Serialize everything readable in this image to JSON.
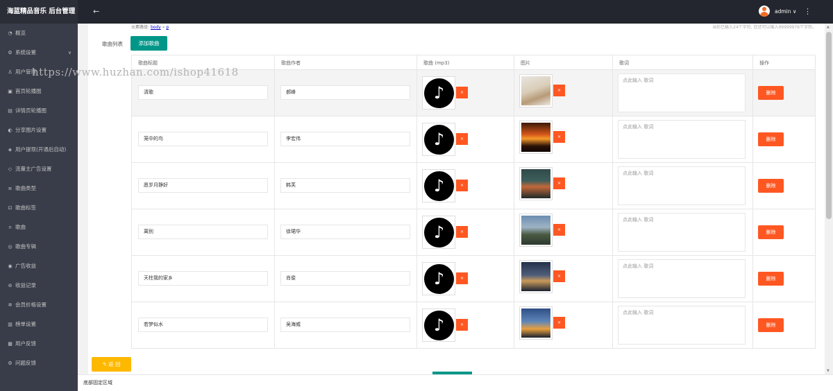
{
  "app": {
    "title": "海蓝精品音乐 后台管理"
  },
  "sidebar": {
    "items": [
      {
        "label": "概览",
        "icon": "gauge-icon",
        "glyph": "◔"
      },
      {
        "label": "系统设置",
        "icon": "gear-icon",
        "glyph": "⚙",
        "has_arrow": true
      },
      {
        "label": "用户管理",
        "icon": "user-icon",
        "glyph": "♙"
      },
      {
        "label": "首页轮播图",
        "icon": "image-icon",
        "glyph": "▣"
      },
      {
        "label": "详情页轮播图",
        "icon": "picture-icon",
        "glyph": "▤"
      },
      {
        "label": "分享图片设置",
        "icon": "share-icon",
        "glyph": "◐"
      },
      {
        "label": "用户提现(开通后自动)",
        "icon": "shield-icon",
        "glyph": "◈"
      },
      {
        "label": "流量主广告设置",
        "icon": "diamond-icon",
        "glyph": "◇"
      },
      {
        "label": "歌曲类型",
        "icon": "list-icon",
        "glyph": "≡"
      },
      {
        "label": "歌曲标签",
        "icon": "tag-icon",
        "glyph": "⊡"
      },
      {
        "label": "歌曲",
        "icon": "headphones-icon",
        "glyph": "∩"
      },
      {
        "label": "歌曲专辑",
        "icon": "album-icon",
        "glyph": "◎"
      },
      {
        "label": "广告收益",
        "icon": "ad-icon",
        "glyph": "◉"
      },
      {
        "label": "收益记录",
        "icon": "record-icon",
        "glyph": "⊚"
      },
      {
        "label": "会员价格设置",
        "icon": "asterisk-icon",
        "glyph": "✲"
      },
      {
        "label": "榜单设置",
        "icon": "rank-icon",
        "glyph": "▥"
      },
      {
        "label": "用户反馈",
        "icon": "feedback-icon",
        "glyph": "▦"
      },
      {
        "label": "问题反馈",
        "icon": "question-icon",
        "glyph": "⚙"
      }
    ]
  },
  "header": {
    "back": "←",
    "user": "admin ∨",
    "more": "⋮"
  },
  "editor": {
    "path_prefix": "元素路径:",
    "path_body": "body",
    "path_sep": "»",
    "path_p": "p",
    "count_text": "当前已输入24个字符, 您还可以输入99999976个字符。"
  },
  "songs": {
    "section_label": "歌曲列表",
    "add_label": "添加歌曲",
    "columns": [
      "歌曲标题",
      "歌曲作者",
      "歌曲 (mp3)",
      "图片",
      "歌词",
      "操作"
    ],
    "music_glyph": "♪",
    "remove_label": "×",
    "delete_label": "删除",
    "lyric_placeholder": "点此输入 歌词",
    "rows": [
      {
        "title": "清歌",
        "author": "郝峰"
      },
      {
        "title": "笼中的鸟",
        "author": "李宏伟"
      },
      {
        "title": "愿岁月静好",
        "author": "韩芙"
      },
      {
        "title": "离别",
        "author": "徐珺华"
      },
      {
        "title": "天柱我的家乡",
        "author": "肖俊"
      },
      {
        "title": "若梦似水",
        "author": "吴海威"
      }
    ]
  },
  "return_label": "返 回",
  "footer": {
    "text": "底部固定区域"
  },
  "watermark": "https://www.huzhan.com/ishop41618",
  "colors": {
    "primary": "#009688",
    "danger": "#ff5722",
    "warn": "#ffb800",
    "sidebar": "#393d49",
    "header": "#23262e"
  }
}
